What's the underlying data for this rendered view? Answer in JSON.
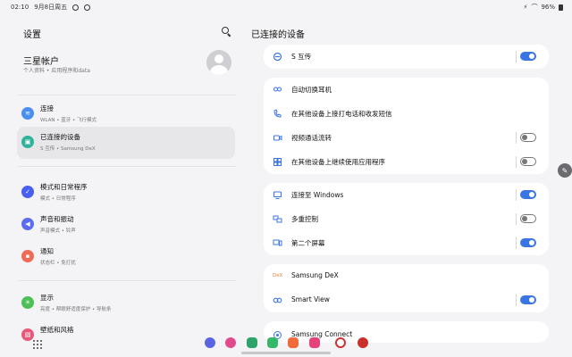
{
  "status_bar": {
    "time": "02:10",
    "date": "9月8日周五",
    "battery": "96%"
  },
  "left_pane": {
    "title": "设置",
    "account": {
      "name": "三星帐户",
      "subtitle": "个人资料 • 应用程序和data"
    },
    "menu": [
      {
        "title": "连接",
        "subtitle": "WLAN • 蓝牙 • 飞行模式",
        "icon": "wifi-icon",
        "color": "#4a8ef0"
      },
      {
        "title": "已连接的设备",
        "subtitle": "S 互传 • Samsung DeX",
        "icon": "connected-devices-icon",
        "color": "#31b39b"
      },
      {
        "title": "模式和日常程序",
        "subtitle": "模式 • 日常程序",
        "icon": "modes-icon",
        "color": "#4a5ef0"
      },
      {
        "title": "声音和振动",
        "subtitle": "声音模式 • 铃声",
        "icon": "sound-icon",
        "color": "#5b6cf0"
      },
      {
        "title": "通知",
        "subtitle": "状态栏 • 免打扰",
        "icon": "notification-icon",
        "color": "#f06a55"
      },
      {
        "title": "显示",
        "subtitle": "亮度 • 帮眼舒适度保护 • 导航条",
        "icon": "display-icon",
        "color": "#4cbf55"
      },
      {
        "title": "壁纸和风格",
        "subtitle": "",
        "icon": "wallpaper-icon",
        "color": "#e8577a"
      }
    ]
  },
  "right_pane": {
    "heading": "已连接的设备",
    "cards": [
      [
        {
          "label": "S 互传",
          "icon": "quick-share-icon",
          "toggle": true
        }
      ],
      [
        {
          "label": "自动切换耳机",
          "icon": "earbuds-icon",
          "toggle": null
        },
        {
          "label": "在其他设备上接打电话和收发短信",
          "icon": "call-text-icon",
          "toggle": null
        },
        {
          "label": "视频通话流转",
          "icon": "video-call-icon",
          "toggle": false
        },
        {
          "label": "在其他设备上继续使用应用程序",
          "icon": "continue-apps-icon",
          "toggle": false
        }
      ],
      [
        {
          "label": "连接至 Windows",
          "icon": "windows-icon",
          "toggle": true
        },
        {
          "label": "多重控制",
          "icon": "multi-control-icon",
          "toggle": false
        },
        {
          "label": "第二个屏幕",
          "icon": "second-screen-icon",
          "toggle": true
        }
      ],
      [
        {
          "label": "Samsung DeX",
          "icon": "dex-icon",
          "icon_text": "DeX",
          "toggle": null
        },
        {
          "label": "Smart View",
          "icon": "smart-view-icon",
          "toggle": true
        }
      ],
      [
        {
          "label": "Samsung Connect",
          "icon": "samsung-connect-icon",
          "toggle": null
        }
      ]
    ]
  },
  "taskbar": {
    "apps": [
      {
        "name": "messages-app",
        "color": "#5a64e0"
      },
      {
        "name": "blossom-app",
        "color": "#e04a8a"
      },
      {
        "name": "shortcut-app",
        "color": "#2fa46a"
      },
      {
        "name": "game-app",
        "color": "#34b86a"
      },
      {
        "name": "contacts-app",
        "color": "#f06a3a"
      },
      {
        "name": "camera-app",
        "color": "#e8407a"
      },
      {
        "name": "dual-app",
        "color": "#d23030"
      },
      {
        "name": "bug-app",
        "color": "#c8322a"
      }
    ]
  },
  "colors": {
    "accent": "#3b74e3",
    "selected": "#e7e7ea"
  }
}
